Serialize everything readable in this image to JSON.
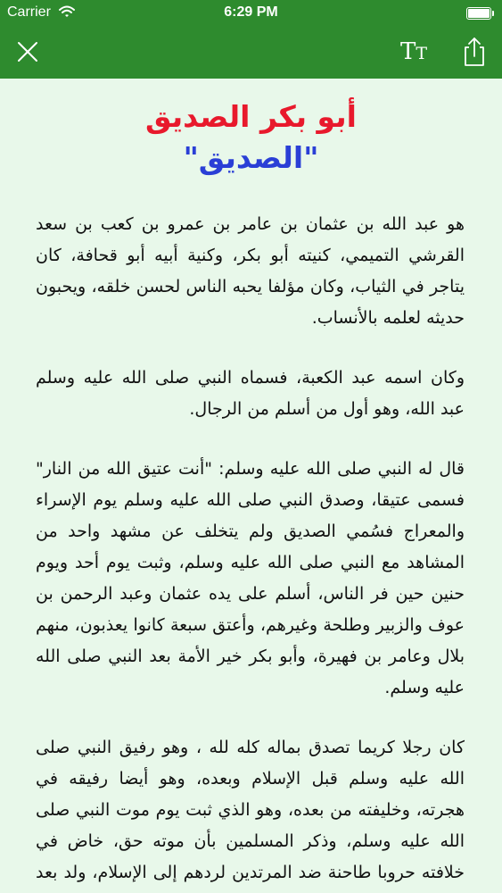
{
  "status_bar": {
    "carrier": "Carrier",
    "time": "6:29 PM"
  },
  "nav": {
    "font_button_label_large": "T",
    "font_button_label_small": "T"
  },
  "article": {
    "title": "أبو بكر الصديق",
    "subtitle": "\"الصديق\"",
    "paragraphs": [
      "هو عبد الله بن عثمان بن عامر بن عمرو بن كعب بن سعد القرشي التميمي، كنيته أبو بكر، وكنية أبيه أبو قحافة، كان يتاجر في الثياب، وكان مؤلفا يحبه الناس لحسن خلقه، ويحبون حديثه لعلمه بالأنساب.",
      "وكان اسمه عبد الكعبة، فسماه النبي صلى الله عليه وسلم عبد الله، وهو أول من أسلم من الرجال.",
      "قال له النبي صلى الله عليه وسلم: \"أنت عتيق الله من النار\" فسمى عتيقا، وصدق النبي صلى الله عليه وسلم يوم الإسراء والمعراج فسُمي الصديق ولم يتخلف عن مشهد واحد من المشاهد مع النبي صلى الله عليه وسلم، وثبت يوم أحد ويوم حنين حين فر الناس، أسلم على يده عثمان وعبد الرحمن بن عوف والزبير وطلحة وغيرهم، وأعتق سبعة كانوا يعذبون، منهم بلال وعامر بن فهيرة، وأبو بكر خير الأمة بعد النبي صلى الله عليه وسلم.",
      "كان رجلا كريما تصدق بماله كله لله ، وهو رفيق النبي صلى الله عليه وسلم قبل الإسلام وبعده، وهو أيضا رفيقه في هجرته، وخليفته من بعده، وهو الذي ثبت يوم موت النبي صلى الله عليه وسلم، وذكر المسلمين بأن موته حق، خاض في خلافته حروبا طاحنة ضد المرتدين لردهم إلى الإسلام، ولد بعد النبي صلى الله عليه وسلم بسنتين"
    ]
  },
  "colors": {
    "nav_background": "#2e8b2e",
    "page_background": "#e8f8ea",
    "title_color": "#e8192c",
    "subtitle_color": "#2a3fd6"
  },
  "icons": {
    "close": "close-icon",
    "font_size": "font-size-icon",
    "share": "share-icon",
    "wifi": "wifi-icon",
    "battery": "battery-icon"
  }
}
